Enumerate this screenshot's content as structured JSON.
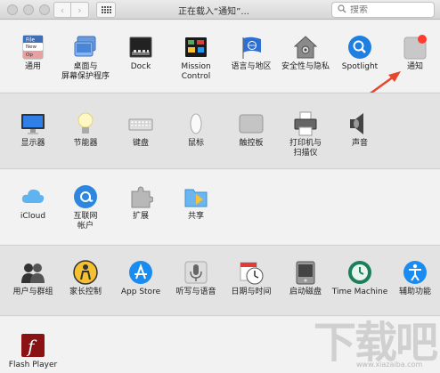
{
  "toolbar": {
    "title": "正在载入“通知”...",
    "search_placeholder": "搜索",
    "back_glyph": "‹",
    "forward_glyph": "›"
  },
  "sections": [
    {
      "items": [
        {
          "label": "通用",
          "icon": "general-icon"
        },
        {
          "label": "桌面与\n屏幕保护程序",
          "icon": "desktop-screensaver-icon"
        },
        {
          "label": "Dock",
          "icon": "dock-icon"
        },
        {
          "label": "Mission\nControl",
          "icon": "mission-control-icon"
        },
        {
          "label": "语言与地区",
          "icon": "language-region-icon"
        },
        {
          "label": "安全性与隐私",
          "icon": "security-privacy-icon"
        },
        {
          "label": "Spotlight",
          "icon": "spotlight-icon"
        },
        {
          "label": "通知",
          "icon": "notifications-icon"
        }
      ]
    },
    {
      "items": [
        {
          "label": "显示器",
          "icon": "displays-icon"
        },
        {
          "label": "节能器",
          "icon": "energy-saver-icon"
        },
        {
          "label": "键盘",
          "icon": "keyboard-icon"
        },
        {
          "label": "鼠标",
          "icon": "mouse-icon"
        },
        {
          "label": "触控板",
          "icon": "trackpad-icon"
        },
        {
          "label": "打印机与\n扫描仪",
          "icon": "printer-scanner-icon"
        },
        {
          "label": "声音",
          "icon": "sound-icon"
        }
      ]
    },
    {
      "items": [
        {
          "label": "iCloud",
          "icon": "icloud-icon"
        },
        {
          "label": "互联网\n帐户",
          "icon": "internet-accounts-icon"
        },
        {
          "label": "扩展",
          "icon": "extensions-icon"
        },
        {
          "label": "共享",
          "icon": "sharing-icon"
        }
      ]
    },
    {
      "items": [
        {
          "label": "用户与群组",
          "icon": "users-groups-icon"
        },
        {
          "label": "家长控制",
          "icon": "parental-controls-icon"
        },
        {
          "label": "App Store",
          "icon": "app-store-icon"
        },
        {
          "label": "听写与语音",
          "icon": "dictation-speech-icon"
        },
        {
          "label": "日期与时间",
          "icon": "date-time-icon"
        },
        {
          "label": "启动磁盘",
          "icon": "startup-disk-icon"
        },
        {
          "label": "Time Machine",
          "icon": "time-machine-icon"
        },
        {
          "label": "辅助功能",
          "icon": "accessibility-icon"
        }
      ]
    },
    {
      "items": [
        {
          "label": "Flash Player",
          "icon": "flash-player-icon"
        }
      ]
    }
  ],
  "icon_text": {
    "general_file": "File",
    "general_new": "New",
    "general_op": "Op",
    "flash_glyph": "f",
    "accessibility_glyph": "♿"
  },
  "watermark": {
    "text": "下载吧",
    "url": "www.xiazaiba.com"
  },
  "colors": {
    "arrow": "#e8452c",
    "badge": "#ff3b30",
    "spotlight": "#1e7fe0",
    "appstore": "#1a8bf0"
  }
}
